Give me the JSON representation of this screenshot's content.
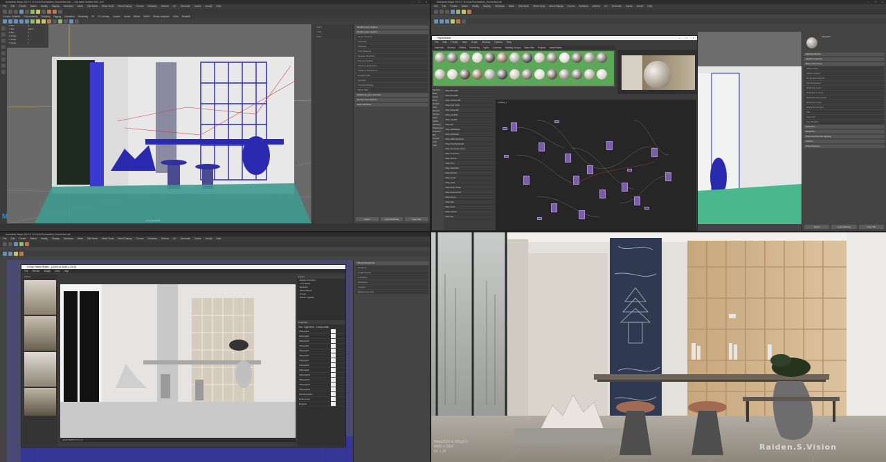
{
  "q1": {
    "title": "Autodesk Maya 2019.2: D:/UUn/Scenes/tea_Scene/tea.mb  ---  Obj table  Untitled  INS_512",
    "menus": [
      "File",
      "Edit",
      "Create",
      "Select",
      "Modify",
      "Display",
      "Windows",
      "Mesh",
      "Edit Mesh",
      "Mesh Tools",
      "Mesh Display",
      "Curves",
      "Surfaces",
      "Deform",
      "UV",
      "Generate",
      "Cache",
      "Arnold",
      "Help"
    ],
    "tabs": [
      "Curves / Surfaces",
      "Poly Modeling",
      "Sculpting",
      "Rigging",
      "Animation",
      "Rendering",
      "FX",
      "FX Caching",
      "Custom",
      "Arnold",
      "Bifrost",
      "MASH",
      "Motion Graphics",
      "XGen",
      "Redshift"
    ],
    "viewport_label": "persp (Redshift)",
    "attr_tab": "Render Layer Options",
    "attr_sections": [
      "Render Layer Options",
      "Multiple Render Overrides",
      "Render Pass Options",
      "Extra Attributes"
    ],
    "attr_rows": [
      "Layer Contents",
      "Geometry",
      "Shadows",
      "Cast Shadows",
      "Receive Shadows",
      "Primary Visibility",
      "Visible In Reflections",
      "Visible In Refractions",
      "Double Sided",
      "Opposite",
      "Smooth Shading",
      "Motion Blur"
    ],
    "buttons": [
      "Select",
      "Load Attributes",
      "Copy Tab"
    ],
    "channel_rows": [
      [
        "X-Rot",
        "0"
      ],
      [
        "Y-Rot",
        "-300.6"
      ],
      [
        "Z-Rot",
        "0"
      ],
      [
        "X-Scale",
        "1"
      ],
      [
        "Y-Scale",
        "1"
      ],
      [
        "Z-Scale",
        "1"
      ]
    ],
    "logo": "M"
  },
  "q2": {
    "title": "Autodesk Maya 2019.2: D:/UUn/Scenes/tea_Scene/tea.mb",
    "hypershade_title": "Hypershade",
    "hs_menus": [
      "File",
      "Edit",
      "Create",
      "Tabs",
      "Graph",
      "Window",
      "Options",
      "Help"
    ],
    "hs_tabs": [
      "Materials",
      "Textures",
      "Utilities",
      "Rendering",
      "Lights",
      "Cameras",
      "Shading Groups",
      "Bake Sets",
      "Projects",
      "Asset Nodes"
    ],
    "create_list": [
      "Favorites",
      "Maya",
      "Arnold",
      "Bifrost",
      "Redshift",
      "VRay",
      "Materials",
      "Textures",
      "Lights",
      "Utilities",
      "Volumetric",
      "Displacement",
      "Projection",
      "Env",
      "General",
      "Color",
      "Other"
    ],
    "vray_list": [
      "VRay BlendMtl",
      "VRay BumpMtl",
      "VRay CarPaintMtl",
      "VRay Fast SSS2",
      "VRay FlakesMtl",
      "VRay Hair3Mtl",
      "VRay LightMtl",
      "VRay Mtl",
      "VRay MtlWrapper",
      "VRay Mtl2Sided",
      "VRay MtlRenderStats",
      "VRay PointParticleMtl",
      "VRay Stochastic Flakes",
      "VRay ALSurface",
      "VRay VRmat",
      "VRay Toon",
      "VRay SwitchMtl",
      "VRay Mtl Hair",
      "VRay Cloud",
      "VRay GLSL",
      "VRay Plugin Node",
      "VRay Scanned Mtl",
      "VRay Stereo",
      "VRay Skin",
      "VRay Texel",
      "VRay Volume",
      "VRay Sky"
    ],
    "node_editor_label": "Untitled_1",
    "swatch_name": "VRayMtl1",
    "attr_sections": [
      "Material Sample",
      "Swatch properties",
      "Basic parameters",
      "Reflection",
      "Refraction",
      "Bump and Normal mapping",
      "Options",
      "Extra Attributes"
    ],
    "attr_rows": [
      "Diffuse Color",
      "Diffuse Amount",
      "Roughness Amount",
      "Self-Illumination",
      "Reflection Color",
      "Reflection Amount",
      "Reflection Glossiness",
      "Refraction Color",
      "Refraction Amount",
      "IOR",
      "Fog Color",
      "Fog Multiplier"
    ],
    "buttons": [
      "Select",
      "Load Attributes",
      "Copy Tab"
    ]
  },
  "q3": {
    "title": "Autodesk Maya 2019.2: D:/UUn/Scenes/tea_Scene/tea.mb",
    "vfb_title": "V-Ray Frame Buffer - [100% of 4096 x 2310]",
    "vfb_menus": [
      "File",
      "Render",
      "Image",
      "View",
      "Help"
    ],
    "history_label": "History",
    "layers_label": "Layers",
    "layer_items": [
      "Display Correction",
      "Lens Effects",
      "Exposure",
      "White balance",
      "Curves",
      "Source: LightMix"
    ],
    "properties_label": "Properties",
    "lightmix_tabs": [
      "Set",
      "Lightmix",
      "Composite"
    ],
    "lightmix_rows": [
      "VRayLight1",
      "VRayLight2",
      "VRayLight3",
      "VRayLight4",
      "VRayLight5",
      "VRayLight6",
      "VRayLight7",
      "VRayLight8",
      "VRayLight9",
      "VRayLight10",
      "VRayLight11",
      "VRayLight12",
      "VRayLight13",
      "Self-illumination",
      "Environment",
      "Residual"
    ],
    "status": "sRGB  RGB  0.0  0.0  0.0",
    "attr_name": "VRaySettingsNode",
    "attr_rows": [
      "Renderer",
      "Image Format",
      "Animation",
      "Resolution",
      "Camera",
      "Background color"
    ]
  },
  "q4": {
    "specs": [
      "Maya2019 & VRay5.0",
      "4096 × 2310",
      "ID: 1.20"
    ],
    "watermark": "Raiden.S.Vision"
  },
  "colors": {
    "maya_bg": "#444444",
    "wire": "#2a2ab0",
    "node": "#7a5fa8",
    "vray_orange": "#d98b39"
  }
}
